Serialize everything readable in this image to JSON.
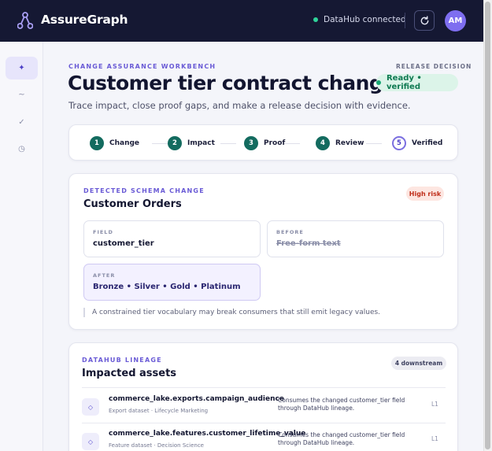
{
  "app": {
    "title": "AssureGraph",
    "connection_status": "DataHub connected",
    "user_initials": "AM",
    "colors": {
      "topbar": "#151833",
      "accent": "#6a5bd6",
      "success": "#17a673",
      "step_done": "#136b5f",
      "risk": "#c02f1b"
    }
  },
  "sidebar": {
    "items": [
      {
        "icon": "✦",
        "icon_name": "sparkle-icon",
        "active": true
      },
      {
        "icon": "~",
        "icon_name": "trend-icon",
        "active": false
      },
      {
        "icon": "✓",
        "icon_name": "check-icon",
        "active": false
      },
      {
        "icon": "◷",
        "icon_name": "clock-icon",
        "active": false
      }
    ]
  },
  "header": {
    "eyebrow": "CHANGE ASSURANCE WORKBENCH",
    "title": "Customer tier contract change",
    "subtitle": "Trace impact, close proof gaps, and make a release decision with evidence.",
    "release_label": "RELEASE DECISION",
    "release_status": "Ready • verified"
  },
  "stepper": {
    "steps": [
      {
        "num": "1",
        "label": "Change",
        "done": true
      },
      {
        "num": "2",
        "label": "Impact",
        "done": true
      },
      {
        "num": "3",
        "label": "Proof",
        "done": true
      },
      {
        "num": "4",
        "label": "Review",
        "done": true
      },
      {
        "num": "5",
        "label": "Verified",
        "done": false
      }
    ]
  },
  "schema_change": {
    "eyebrow": "DETECTED SCHEMA CHANGE",
    "title": "Customer Orders",
    "risk": "High risk",
    "field_label": "FIELD",
    "field_value": "customer_tier",
    "before_label": "BEFORE",
    "before_value": "Free-form text",
    "after_label": "AFTER",
    "after_value": "Bronze • Silver • Gold • Platinum",
    "note": "A constrained tier vocabulary may break consumers that still emit legacy values."
  },
  "lineage": {
    "eyebrow": "DATAHUB LINEAGE",
    "title": "Impacted assets",
    "count": "4 downstream",
    "assets": [
      {
        "name": "commerce_lake.exports.campaign_audience",
        "meta": "Export dataset · Lifecycle Marketing",
        "desc": "Consumes the changed customer_tier field through DataHub lineage.",
        "level": "L1"
      },
      {
        "name": "commerce_lake.features.customer_lifetime_value",
        "meta": "Feature dataset · Decision Science",
        "desc": "Consumes the changed customer_tier field through DataHub lineage.",
        "level": "L1"
      }
    ]
  }
}
